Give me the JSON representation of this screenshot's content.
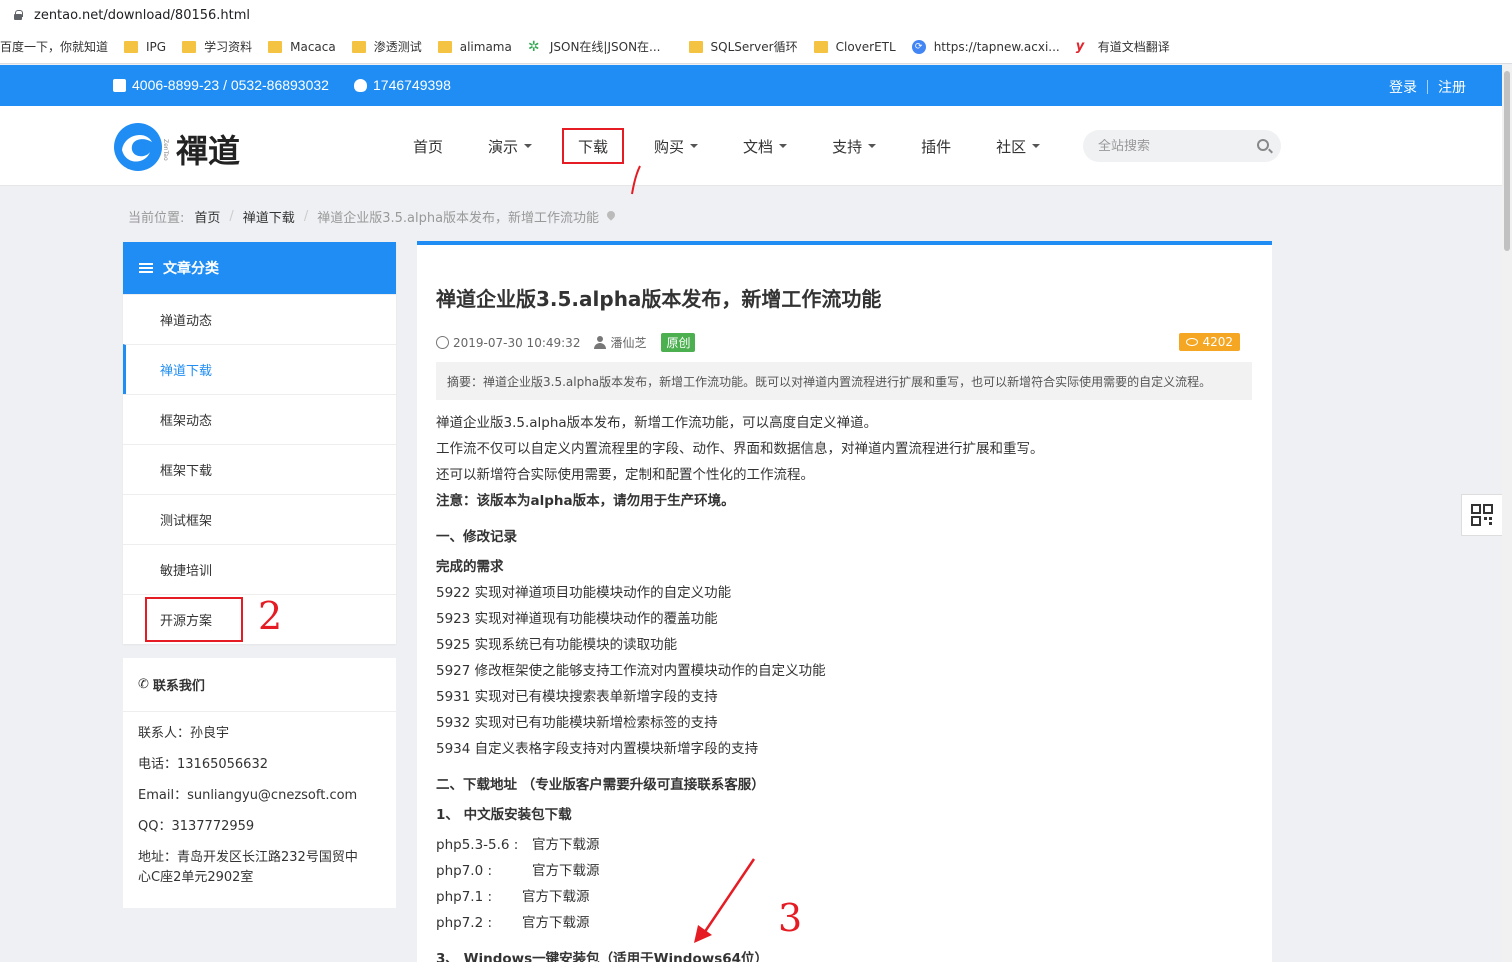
{
  "browser": {
    "url": "zentao.net/download/80156.html",
    "bookmarks": [
      "百度一下，你就知道",
      "IPG",
      "学习资料",
      "Macaca",
      "渗透测试",
      "alimama",
      "JSON在线|JSON在...",
      "SQLServer循环",
      "CloverETL",
      "https://tapnew.acxi...",
      "有道文档翻译"
    ]
  },
  "topbar": {
    "phone": "4006-8899-23 / 0532-86893032",
    "qq": "1746749398",
    "login": "登录",
    "register": "注册",
    "bg_color": "#1f8df3"
  },
  "logo": {
    "text": "禪道",
    "sub": "ZenTao"
  },
  "nav": {
    "items": [
      "首页",
      "演示",
      "下载",
      "购买",
      "文档",
      "支持",
      "插件",
      "社区"
    ],
    "search_placeholder": "全站搜索"
  },
  "breadcrumb": {
    "prefix": "当前位置:",
    "home": "首页",
    "section": "禅道下载",
    "current": "禅道企业版3.5.alpha版本发布，新增工作流功能"
  },
  "sidebar": {
    "title": "文章分类",
    "items": [
      "禅道动态",
      "禅道下载",
      "框架动态",
      "框架下载",
      "测试框架",
      "敏捷培训",
      "开源方案"
    ],
    "contact_title": "联系我们",
    "contact": {
      "person": "联系人：孙良宇",
      "phone": "电话：13165056632",
      "email": "Email：sunliangyu@cnezsoft.com",
      "qq": "QQ：3137772959",
      "address1": "地址：青岛开发区长江路232号国贸中",
      "address2": "心C座2单元2902室"
    }
  },
  "article": {
    "title": "禅道企业版3.5.alpha版本发布，新增工作流功能",
    "date": "2019-07-30 10:49:32",
    "author": "潘仙芝",
    "badge": "原创",
    "views": "4202",
    "summary": "摘要：禅道企业版3.5.alpha版本发布，新增工作流功能。既可以对禅道内置流程进行扩展和重写，也可以新增符合实际使用需要的自定义流程。",
    "paragraphs": [
      "禅道企业版3.5.alpha版本发布，新增工作流功能，可以高度自定义禅道。",
      "工作流不仅可以自定义内置流程里的字段、动作、界面和数据信息，对禅道内置流程进行扩展和重写。",
      "还可以新增符合实际使用需要，定制和配置个性化的工作流程。",
      "注意：该版本为alpha版本，请勿用于生产环境。"
    ],
    "section1": "一、修改记录",
    "done_title": "完成的需求",
    "requirements": [
      "5922 实现对禅道项目功能模块动作的自定义功能",
      "5923 实现对禅道现有功能模块动作的覆盖功能",
      "5925 实现系统已有功能模块的读取功能",
      "5927 修改框架使之能够支持工作流对内置模块动作的自定义功能",
      "5931 实现对已有模块搜索表单新增字段的支持",
      "5932 实现对已有功能模块新增检索标签的支持",
      "5934 自定义表格字段支持对内置模块新增字段的支持"
    ],
    "section2": "二、下载地址 （专业版客户需要升级可直接联系客服）",
    "sub1": "1、 中文版安装包下载",
    "downloads": [
      {
        "ver": "php5.3-5.6 :",
        "link": "官方下载源"
      },
      {
        "ver": "php7.0      :",
        "link": "官方下载源"
      },
      {
        "ver": "php7.1    :",
        "link": "官方下载源"
      },
      {
        "ver": "php7.2    :",
        "link": "官方下载源"
      }
    ],
    "sub3": "3、 Windows一键安装包（适用于Windows64位）"
  },
  "annotations": [
    "1",
    "2",
    "3"
  ],
  "accent_color": "#1f8df3",
  "annotation_color": "#e51c23"
}
